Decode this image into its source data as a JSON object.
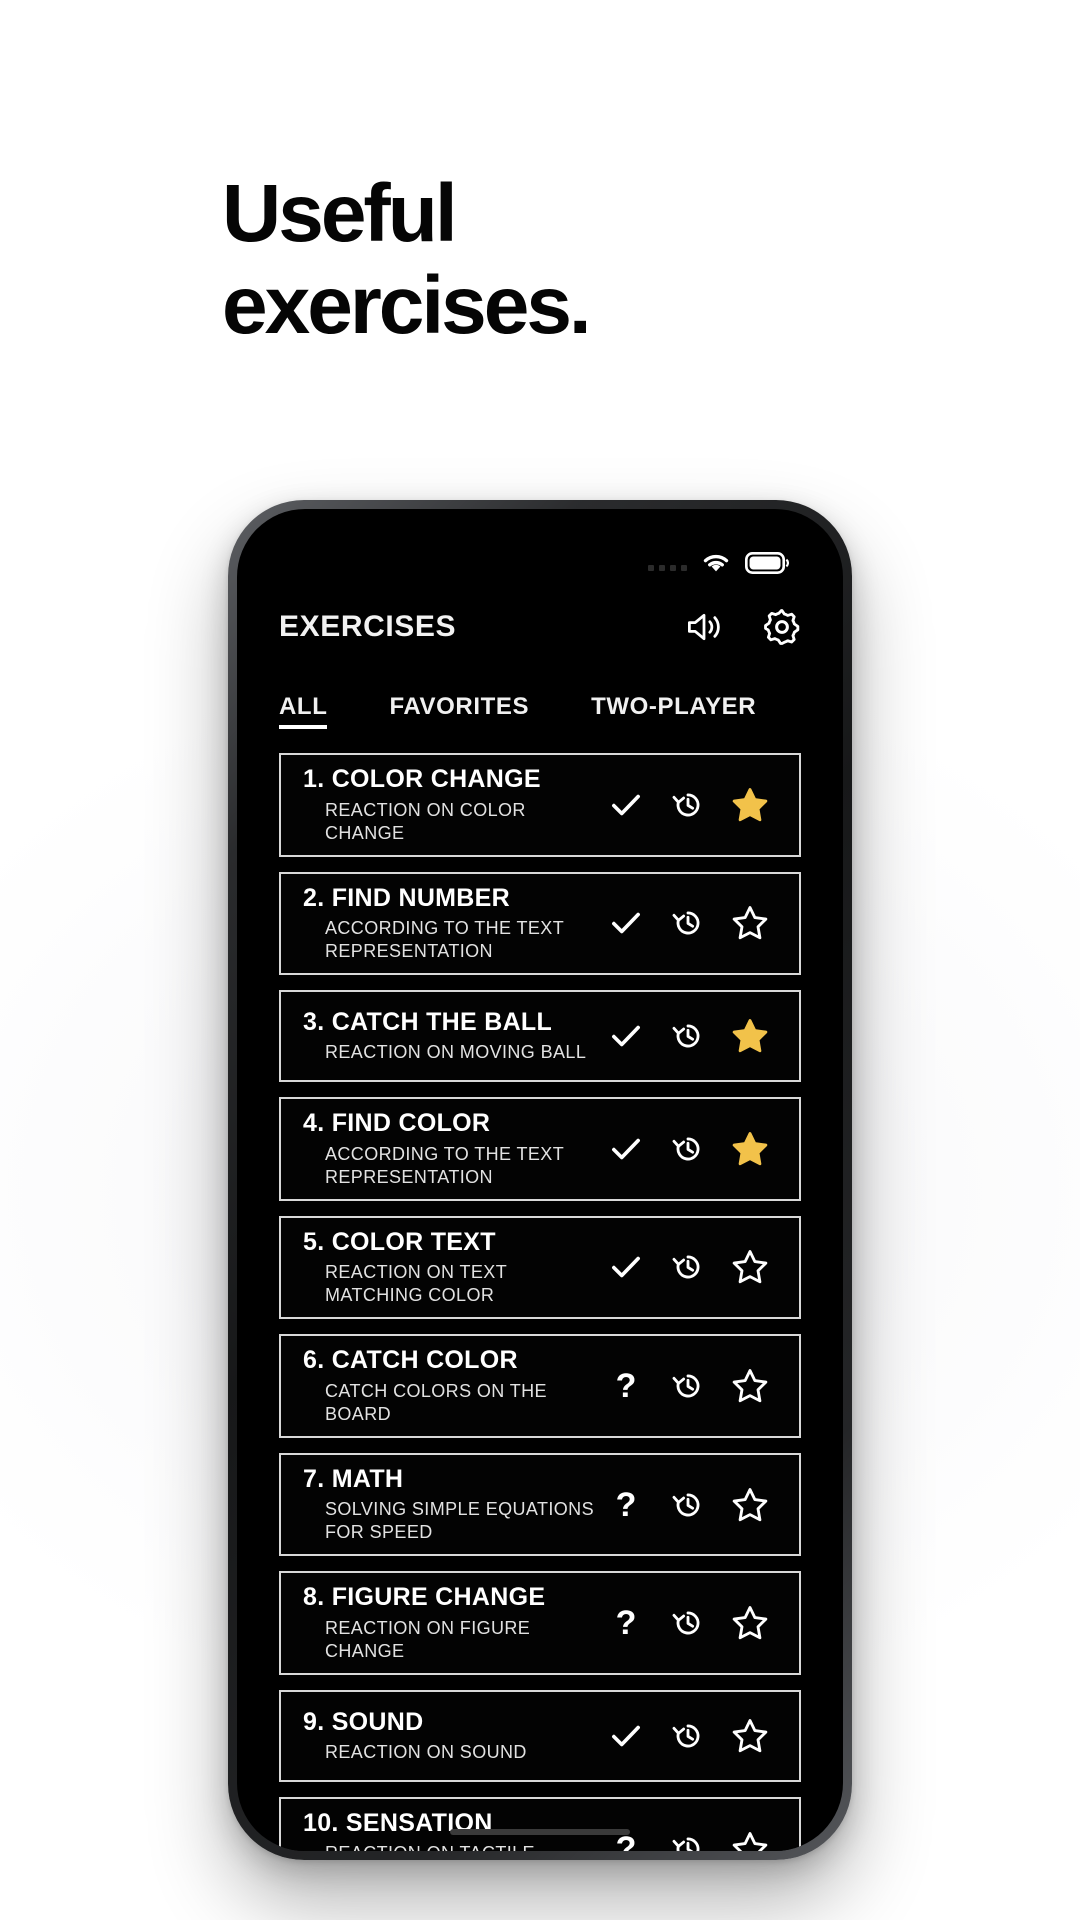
{
  "headline": {
    "line1": "Useful",
    "line2": "exercises."
  },
  "statusbar": {
    "signal_icon": "signal-dots-icon",
    "wifi_icon": "wifi-icon",
    "battery_icon": "battery-full-icon"
  },
  "header": {
    "title": "EXERCISES",
    "volume_icon": "volume-icon",
    "settings_icon": "gear-icon"
  },
  "tabs": [
    {
      "label": "ALL",
      "active": true
    },
    {
      "label": "FAVORITES",
      "active": false
    },
    {
      "label": "TWO-PLAYER",
      "active": false
    }
  ],
  "colors": {
    "star_filled": "#F2C24A",
    "accent_text": "#FFFFFF",
    "screen_bg": "#000000",
    "row_border": "#D8D8D8"
  },
  "actions": {
    "check_icon": "check-icon",
    "question_icon": "question-mark-icon",
    "history_icon": "history-icon",
    "star_icon": "star-icon"
  },
  "exercises": [
    {
      "num": "1.",
      "title": "COLOR CHANGE",
      "subtitle": "REACTION ON COLOR CHANGE",
      "status": "check",
      "favorite": true
    },
    {
      "num": "2.",
      "title": "FIND NUMBER",
      "subtitle": "ACCORDING TO THE TEXT REPRESENTATION",
      "status": "check",
      "favorite": false
    },
    {
      "num": "3.",
      "title": "CATCH THE BALL",
      "subtitle": "REACTION ON MOVING BALL",
      "status": "check",
      "favorite": true
    },
    {
      "num": "4.",
      "title": "FIND COLOR",
      "subtitle": "ACCORDING TO THE TEXT REPRESENTATION",
      "status": "check",
      "favorite": true
    },
    {
      "num": "5.",
      "title": "COLOR TEXT",
      "subtitle": "REACTION ON TEXT MATCHING COLOR",
      "status": "check",
      "favorite": false
    },
    {
      "num": "6.",
      "title": "CATCH COLOR",
      "subtitle": "CATCH COLORS ON THE BOARD",
      "status": "question",
      "favorite": false
    },
    {
      "num": "7.",
      "title": "MATH",
      "subtitle": "SOLVING SIMPLE EQUATIONS FOR SPEED",
      "status": "question",
      "favorite": false
    },
    {
      "num": "8.",
      "title": "FIGURE CHANGE",
      "subtitle": "REACTION ON FIGURE CHANGE",
      "status": "question",
      "favorite": false
    },
    {
      "num": "9.",
      "title": "SOUND",
      "subtitle": "REACTION ON SOUND",
      "status": "check",
      "favorite": false
    },
    {
      "num": "10.",
      "title": "SENSATION",
      "subtitle": "REACTION ON TACTILE SENSATION",
      "status": "question",
      "favorite": false
    }
  ]
}
